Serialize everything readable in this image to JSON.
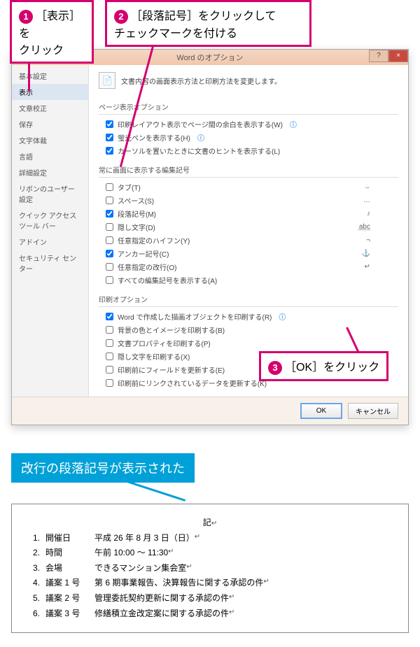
{
  "callouts": {
    "c1_num": "1",
    "c1_text": "［表示］を\nクリック",
    "c2_num": "2",
    "c2_text": "［段落記号］をクリックして\nチェックマークを付ける",
    "c3_num": "3",
    "c3_text": "［OK］をクリック",
    "result": "改行の段落記号が表示された"
  },
  "dialog": {
    "title": "Word のオプション",
    "head": "文書内容の画面表示方法と印刷方法を変更します。",
    "sidebar": [
      "基本設定",
      "表示",
      "文章校正",
      "保存",
      "文字体裁",
      "言語",
      "詳細設定",
      "リボンのユーザー設定",
      "クイック アクセス ツール バー",
      "アドイン",
      "セキュリティ センター"
    ],
    "sec1": "ページ表示オプション",
    "opt1": "印刷レイアウト表示でページ間の余白を表示する(W)",
    "opt2": "蛍光ペンを表示する(H)",
    "opt3": "カーソルを置いたときに文書のヒントを表示する(L)",
    "sec2": "常に画面に表示する編集記号",
    "m1": "タブ(T)",
    "s1": "→",
    "m2": "スペース(S)",
    "s2": "…",
    "m3": "段落記号(M)",
    "s3": "♪",
    "m4": "隠し文字(D)",
    "s4": "abc",
    "m5": "任意指定のハイフン(Y)",
    "s5": "¬",
    "m6": "アンカー記号(C)",
    "s6": "⚓",
    "m7": "任意指定の改行(O)",
    "s7": "↵",
    "m8": "すべての編集記号を表示する(A)",
    "sec3": "印刷オプション",
    "p1": "Word で作成した描画オブジェクトを印刷する(R)",
    "p2": "背景の色とイメージを印刷する(B)",
    "p3": "文書プロパティを印刷する(P)",
    "p4": "隠し文字を印刷する(X)",
    "p5": "印刷前にフィールドを更新する(E)",
    "p6": "印刷前にリンクされているデータを更新する(K)",
    "btn_ok": "OK",
    "btn_cancel": "キャンセル"
  },
  "doc": {
    "title_char": "記",
    "pm": "↵",
    "items": [
      {
        "n": "1.",
        "lbl": "開催日",
        "val": "平成 26 年 8 月 3 日（日）"
      },
      {
        "n": "2.",
        "lbl": "時間",
        "val": "午前 10:00 ～ 11:30"
      },
      {
        "n": "3.",
        "lbl": "会場",
        "val": "できるマンション集会室"
      },
      {
        "n": "4.",
        "lbl": "議案 1 号",
        "val": "第 6 期事業報告、決算報告に関する承認の件"
      },
      {
        "n": "5.",
        "lbl": "議案 2 号",
        "val": "管理委託契約更新に関する承認の件"
      },
      {
        "n": "6.",
        "lbl": "議案 3 号",
        "val": "修繕積立金改定案に関する承認の件"
      }
    ]
  }
}
